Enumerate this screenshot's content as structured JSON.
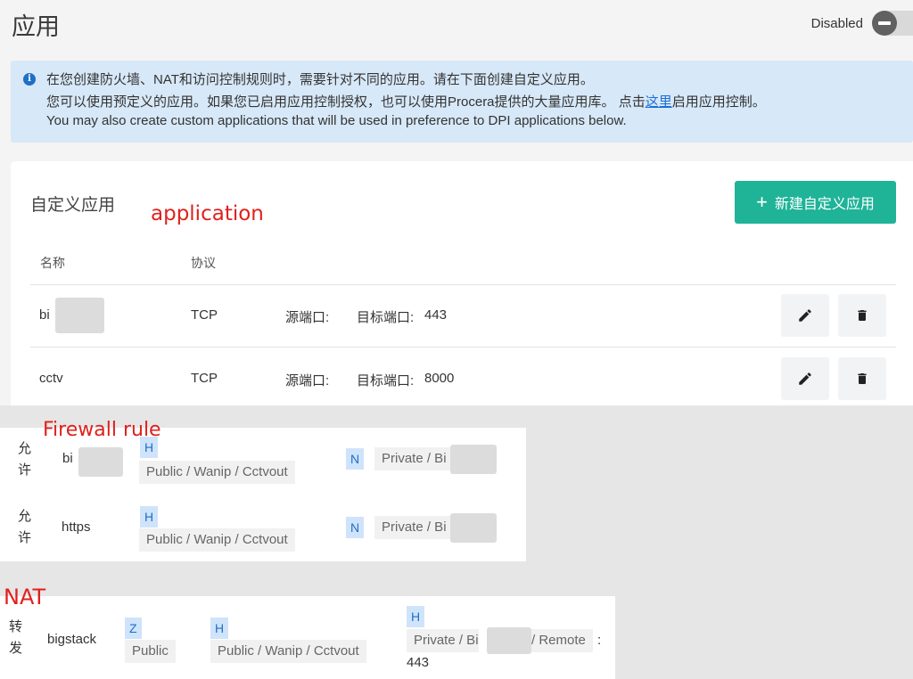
{
  "page": {
    "title": "应用"
  },
  "toggle": {
    "label": "Disabled"
  },
  "banner": {
    "icon": "info-icon",
    "line1": "在您创建防火墙、NAT和访问控制规则时，需要针对不同的应用。请在下面创建自定义应用。",
    "line2_before": "您可以使用预定义的应用。如果您已启用应用控制授权，也可以使用Procera提供的大量应用库。 点击",
    "line2_link": "这里",
    "line2_after": "启用应用控制。",
    "line3": "You may also create custom applications that will be used in preference to DPI applications below."
  },
  "custom_apps": {
    "title": "自定义应用",
    "annotation": "application",
    "add_button": "新建自定义应用",
    "columns": {
      "name": "名称",
      "protocol": "协议"
    },
    "rows": [
      {
        "name": "bi",
        "protocol": "TCP",
        "src_label": "源端口:",
        "dst_label": "目标端口:",
        "dst_port": "443"
      },
      {
        "name": "cctv",
        "protocol": "TCP",
        "src_label": "源端口:",
        "dst_label": "目标端口:",
        "dst_port": "8000"
      }
    ],
    "edit_icon": "pencil-icon",
    "delete_icon": "trash-icon"
  },
  "firewall": {
    "annotation": "Firewall rule",
    "rows": [
      {
        "action": [
          "允",
          "许"
        ],
        "name": "bi",
        "src_tag": "H",
        "src": "Public / Wanip / Cctvout",
        "dst_tag": "N",
        "dst": "Private / Bi"
      },
      {
        "action": [
          "允",
          "许"
        ],
        "name": "https",
        "src_tag": "H",
        "src": "Public / Wanip / Cctvout",
        "dst_tag": "N",
        "dst": "Private / Bi"
      }
    ]
  },
  "nat": {
    "annotation": "NAT",
    "row": {
      "action": [
        "转",
        "发"
      ],
      "name": "bigstack",
      "zone_tag": "Z",
      "zone": "Public",
      "src_tag": "H",
      "src": "Public / Wanip / Cctvout",
      "dst_tag": "H",
      "dst_prefix": "Private / Bi",
      "dst_suffix": "/ Remote",
      "colon": ":",
      "port": "443"
    }
  },
  "colors": {
    "accent": "#1fb398",
    "tag_bg": "#cfe4fb",
    "tag_fg": "#1f6fc4",
    "annotation": "#e0201d",
    "banner_bg": "#d7e8f8"
  }
}
